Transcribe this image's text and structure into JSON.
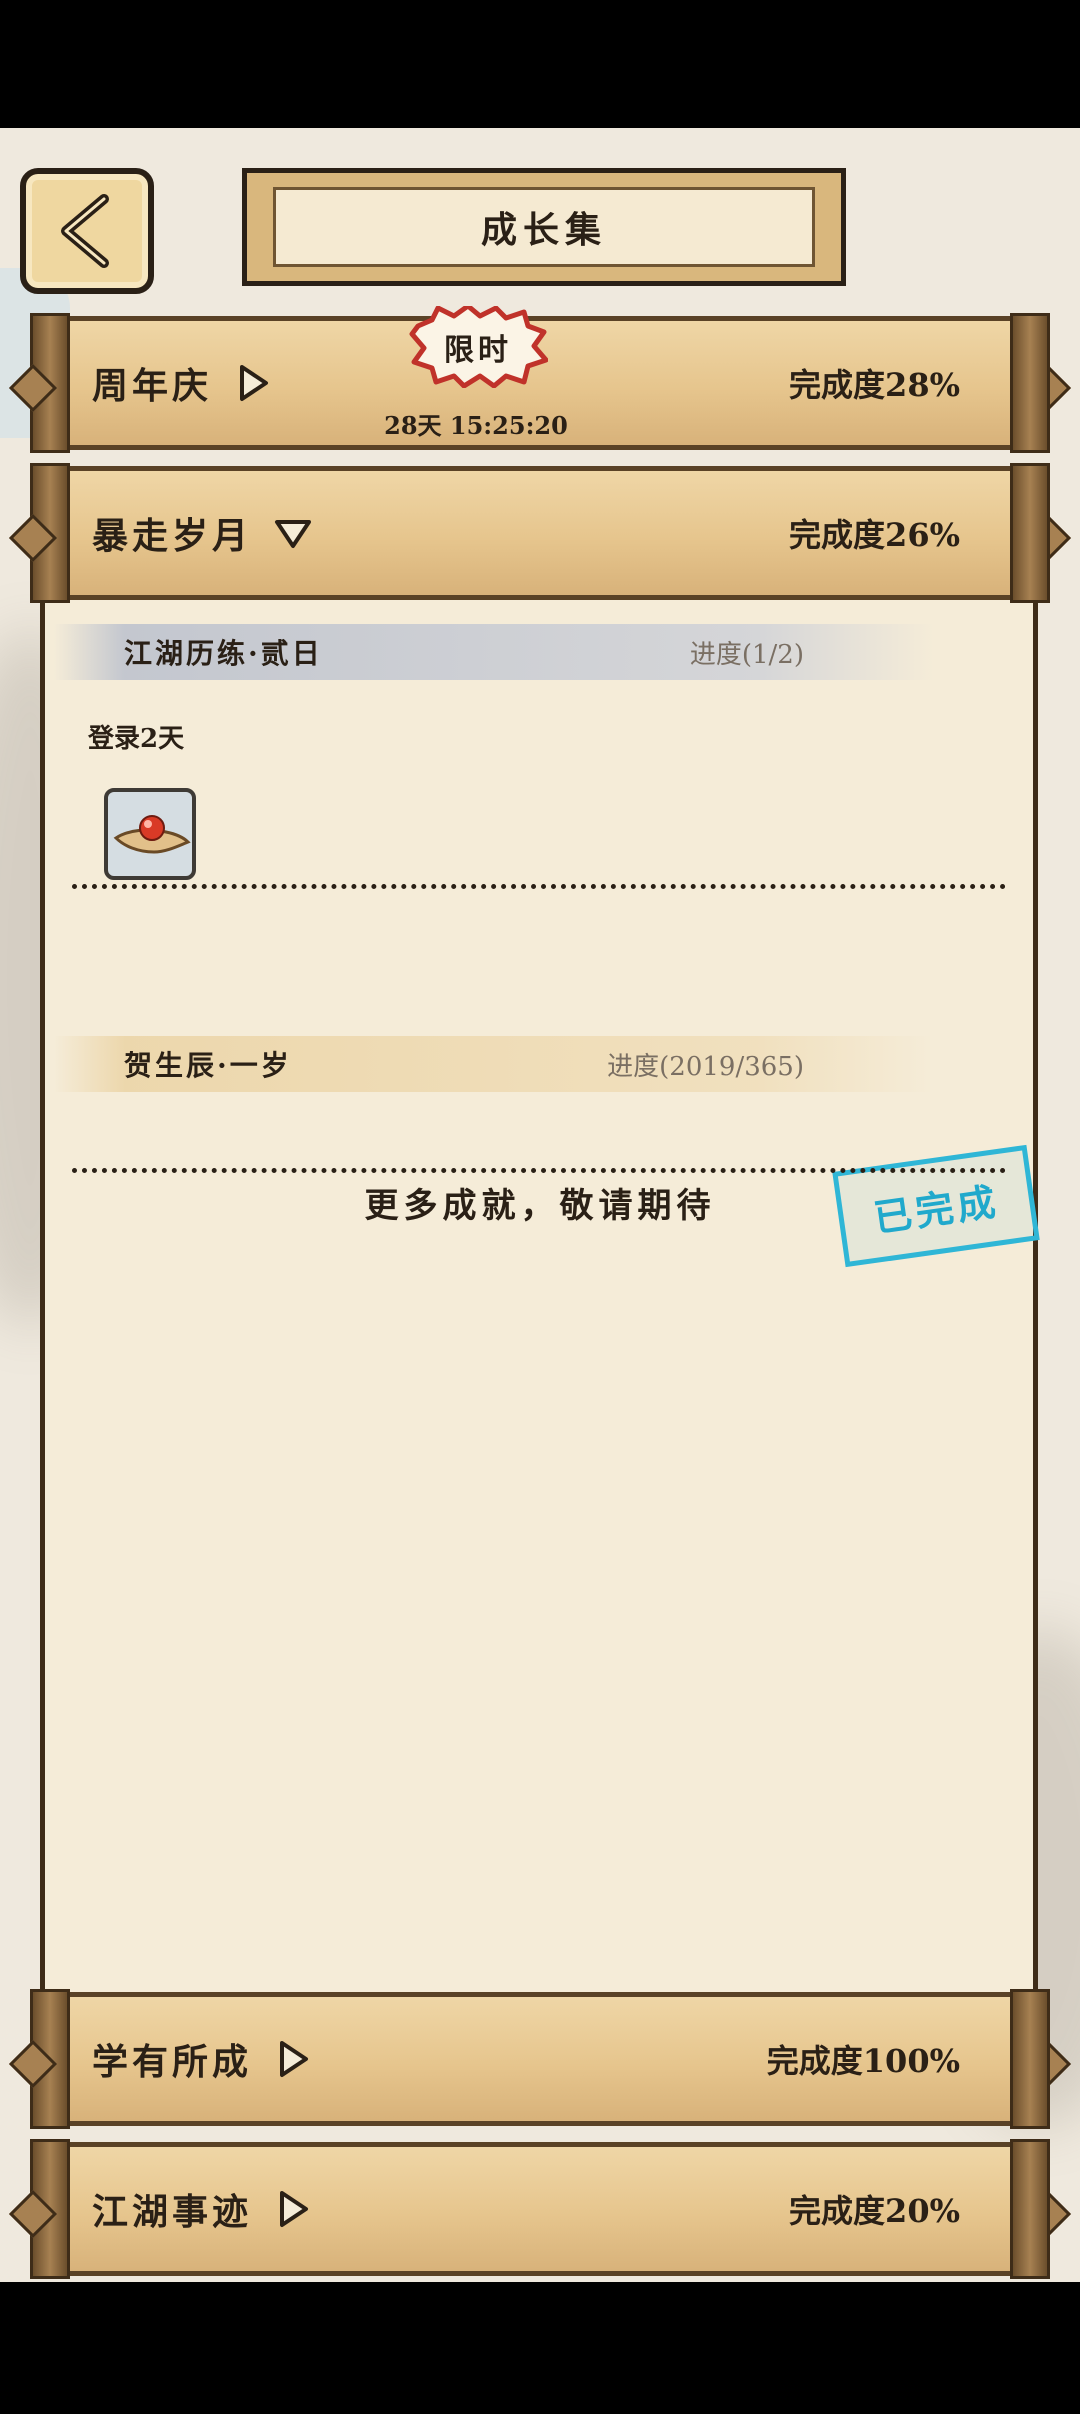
{
  "header": {
    "title": "成长集"
  },
  "limited_badge": {
    "label": "限时",
    "timer": "28天 15:25:20"
  },
  "categories": [
    {
      "name": "周年庆",
      "progress": "完成度28%"
    },
    {
      "name": "暴走岁月",
      "progress": "完成度26%"
    },
    {
      "name": "学有所成",
      "progress": "完成度100%"
    },
    {
      "name": "江湖事迹",
      "progress": "完成度20%"
    }
  ],
  "tasks": [
    {
      "title": "江湖历练·贰日",
      "progress": "进度(1/2)",
      "desc": "登录2天",
      "reward_icon": "red-orb-on-cloth-icon"
    },
    {
      "title": "贺生辰·一岁",
      "progress": "进度(2019/365)",
      "stamp": "已完成"
    }
  ],
  "more_text": "更多成就，敬请期待",
  "colors": {
    "stamp": "#2fb6d6",
    "bar": "#e6c58d",
    "paper": "#f5ecd8",
    "ink": "#2a2016"
  }
}
